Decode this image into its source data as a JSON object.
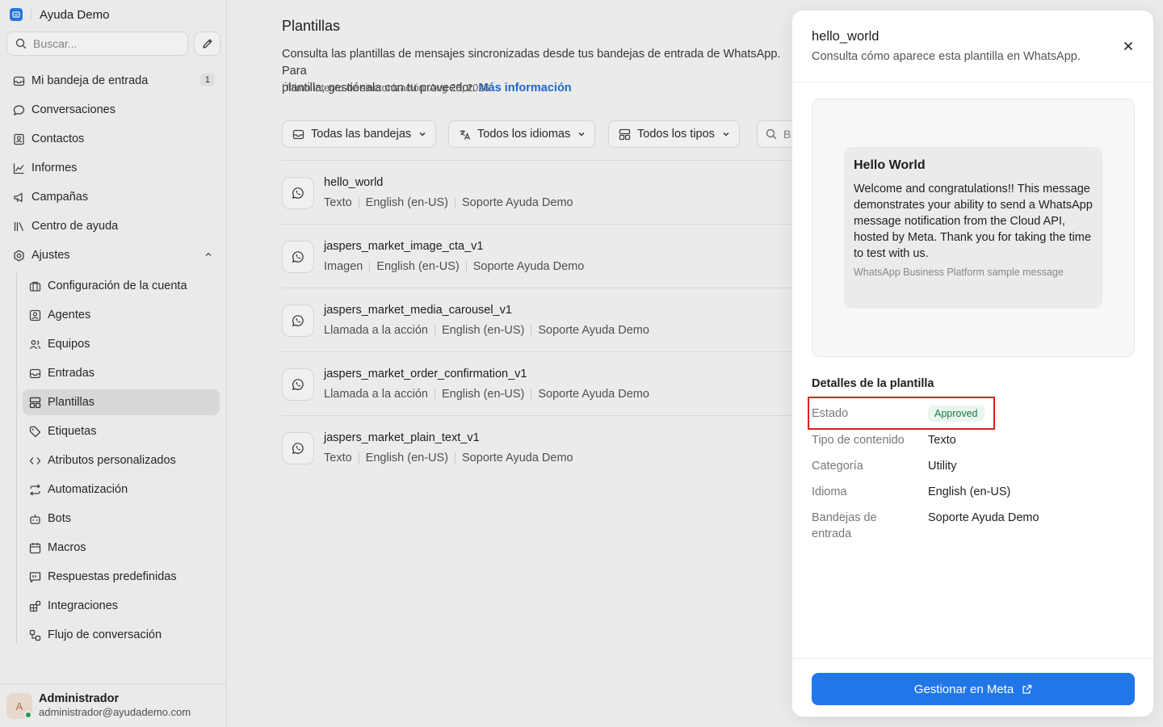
{
  "app": {
    "name": "Ayuda Demo"
  },
  "sidebar": {
    "search_placeholder": "Buscar...",
    "items": [
      {
        "label": "Mi bandeja de entrada",
        "count": "1"
      },
      {
        "label": "Conversaciones"
      },
      {
        "label": "Contactos"
      },
      {
        "label": "Informes"
      },
      {
        "label": "Campañas"
      },
      {
        "label": "Centro de ayuda"
      },
      {
        "label": "Ajustes"
      }
    ],
    "settings": [
      {
        "label": "Configuración de la cuenta"
      },
      {
        "label": "Agentes"
      },
      {
        "label": "Equipos"
      },
      {
        "label": "Entradas"
      },
      {
        "label": "Plantillas",
        "active": true
      },
      {
        "label": "Etiquetas"
      },
      {
        "label": "Atributos personalizados"
      },
      {
        "label": "Automatización"
      },
      {
        "label": "Bots"
      },
      {
        "label": "Macros"
      },
      {
        "label": "Respuestas predefinidas"
      },
      {
        "label": "Integraciones"
      },
      {
        "label": "Flujo de conversación"
      }
    ],
    "user": {
      "initial": "A",
      "name": "Administrador",
      "email": "administrador@ayudademo.com"
    }
  },
  "main": {
    "title": "Plantillas",
    "description": "Consulta las plantillas de mensajes sincronizadas desde tus bandejas de entrada de WhatsApp. Para",
    "description_2": "plantilla, gestiónala con tu proveedor.",
    "more_link": "Más información",
    "sync": "Último intento de sincronización: Aug 28, 2026",
    "filters": {
      "inboxes": "Todas las bandejas",
      "languages": "Todos los idiomas",
      "types": "Todos los tipos",
      "search_placeholder": "B"
    },
    "templates": [
      {
        "name": "hello_world",
        "type": "Texto",
        "language": "English (en-US)",
        "inbox": "Soporte Ayuda Demo"
      },
      {
        "name": "jaspers_market_image_cta_v1",
        "type": "Imagen",
        "language": "English (en-US)",
        "inbox": "Soporte Ayuda Demo"
      },
      {
        "name": "jaspers_market_media_carousel_v1",
        "type": "Llamada a la acción",
        "language": "English (en-US)",
        "inbox": "Soporte Ayuda Demo"
      },
      {
        "name": "jaspers_market_order_confirmation_v1",
        "type": "Llamada a la acción",
        "language": "English (en-US)",
        "inbox": "Soporte Ayuda Demo"
      },
      {
        "name": "jaspers_market_plain_text_v1",
        "type": "Texto",
        "language": "English (en-US)",
        "inbox": "Soporte Ayuda Demo"
      }
    ]
  },
  "drawer": {
    "title": "hello_world",
    "subtitle": "Consulta cómo aparece esta plantilla en WhatsApp.",
    "preview": {
      "title": "Hello World",
      "body": "Welcome and congratulations!! This message demonstrates your ability to send a WhatsApp message notification from the Cloud API, hosted by Meta. Thank you for taking the time to test with us.",
      "footer": "WhatsApp Business Platform sample message"
    },
    "details_heading": "Detalles de la plantilla",
    "details": {
      "status_label": "Estado",
      "status_value": "Approved",
      "content_type_label": "Tipo de contenido",
      "content_type_value": "Texto",
      "category_label": "Categoría",
      "category_value": "Utility",
      "language_label": "Idioma",
      "language_value": "English (en-US)",
      "inboxes_label_1": "Bandejas de",
      "inboxes_label_2": "entrada",
      "inboxes_value": "Soporte Ayuda Demo"
    },
    "manage_button": "Gestionar en Meta"
  },
  "colors": {
    "accent": "#2176e8",
    "link": "#1f6fd8",
    "approved_bg": "#e8f6ee",
    "approved_text": "#1c7a44",
    "highlight": "#e02020"
  }
}
